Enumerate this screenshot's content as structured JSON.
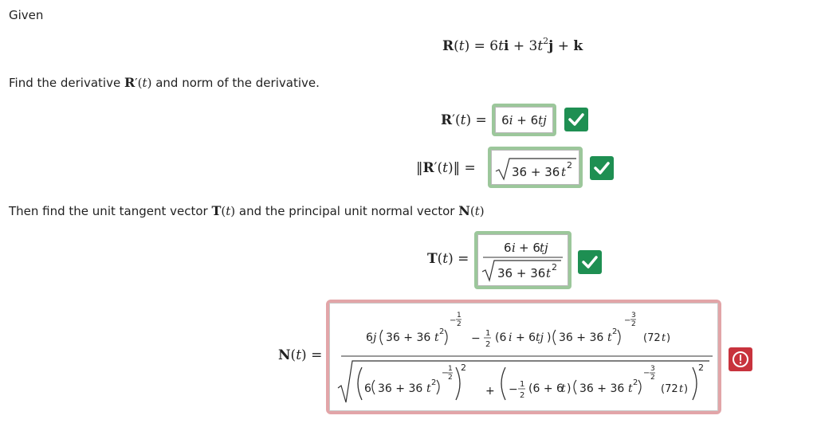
{
  "labels": {
    "given": "Given",
    "find_derivative_pre": "Find the derivative",
    "find_derivative_post": "and norm of the derivative.",
    "then_find_pre": "Then find the unit tangent vector",
    "then_find_mid": "and the principal unit normal vector"
  },
  "math": {
    "R_of_t": "R(t) = 6ti + 3t",
    "R_of_t_sup": "2",
    "R_of_t_tail": "j + k",
    "Rprime_inline": "R′(t)",
    "T_inline": "T(t)",
    "N_inline": "N(t)",
    "Rprime_label": "R′(t) =",
    "norm_label": "‖R′(t)‖ =",
    "T_label": "T(t) =",
    "N_label": "N(t) ="
  },
  "answers": {
    "derivative": "6i + 6tj",
    "norm_radicand": "36 + 36t",
    "norm_sup": "2",
    "T_numerator": "6i + 6tj",
    "T_den_radicand": "36 + 36t",
    "T_den_sup": "2",
    "N_num_part1": "6j",
    "N_num_paren": "36 + 36t",
    "N_num_exp1": "−",
    "N_num_minus_half": "−",
    "N_num_vec": "6i + 6tj",
    "N_num_paren2": "36 + 36t",
    "N_num_tail": "(72t)",
    "N_den_a": "6",
    "N_den_paren": "36 + 36t",
    "N_den_plus": "+",
    "N_den_b": "(6 + 6t)",
    "N_den_paren2": "36 + 36t",
    "N_den_tail": "(72t)",
    "two": "2",
    "one": "1",
    "three": "3"
  },
  "status": {
    "derivative": "correct",
    "norm": "correct",
    "T": "correct",
    "N": "incorrect"
  },
  "colors": {
    "correct_border": "#9cc79b",
    "correct_badge": "#1e8f52",
    "incorrect_border": "#e2a5a8",
    "incorrect_badge": "#c8333d"
  },
  "icons": {
    "correct": "check-icon",
    "incorrect": "alert-circle-icon"
  }
}
